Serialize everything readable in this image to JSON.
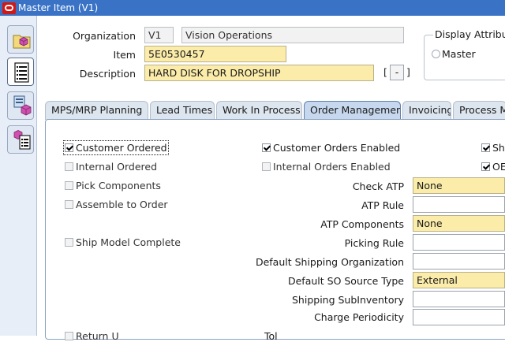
{
  "window": {
    "title": "Master Item (V1)"
  },
  "header": {
    "organization_label": "Organization",
    "organization_code": "V1",
    "organization_name": "Vision Operations",
    "item_label": "Item",
    "item_value": "5E0530457",
    "description_label": "Description",
    "description_value": "HARD DISK FOR DROPSHIP",
    "desc_open": "[",
    "desc_button": "-",
    "desc_close": "]"
  },
  "display_attributes": {
    "title": "Display Attribut",
    "master_label": "Master"
  },
  "tabs": [
    {
      "label": "MPS/MRP Planning"
    },
    {
      "label": "Lead Times"
    },
    {
      "label": "Work In Process"
    },
    {
      "label": "Order Management"
    },
    {
      "label": "Invoicing"
    },
    {
      "label": "Process M"
    }
  ],
  "order_management": {
    "left_checks": [
      {
        "label": "Customer Ordered",
        "checked": true
      },
      {
        "label": "Internal Ordered",
        "checked": false
      },
      {
        "label": "Pick Components",
        "checked": false
      },
      {
        "label": "Assemble to Order",
        "checked": false
      },
      {
        "label": "Ship Model Complete",
        "checked": false
      }
    ],
    "mid_checks": [
      {
        "label": "Customer Orders Enabled",
        "checked": true
      },
      {
        "label": "Internal Orders Enabled",
        "checked": false
      }
    ],
    "right_checks": [
      {
        "label": "Sh",
        "checked": true
      },
      {
        "label": "OE",
        "checked": true
      }
    ],
    "fields": [
      {
        "label": "Check ATP",
        "value": "None"
      },
      {
        "label": "ATP Rule",
        "value": ""
      },
      {
        "label": "ATP Components",
        "value": "None"
      },
      {
        "label": "Picking Rule",
        "value": ""
      },
      {
        "label": "Default Shipping Organization",
        "value": ""
      },
      {
        "label": "Default SO Source Type",
        "value": "External"
      },
      {
        "label": "Shipping SubInventory",
        "value": ""
      },
      {
        "label": "Charge Periodicity",
        "value": ""
      }
    ],
    "bottom_partial_left": "Return U",
    "bottom_partial_mid": "Tol"
  },
  "colors": {
    "titlebar": "#3a73c6",
    "required_field": "#fbecaa",
    "active_tab": "#c7d8ee"
  },
  "icons": {
    "toolbar": [
      "folder-cube-icon",
      "list-document-icon",
      "org-assign-icon",
      "categories-icon"
    ]
  }
}
